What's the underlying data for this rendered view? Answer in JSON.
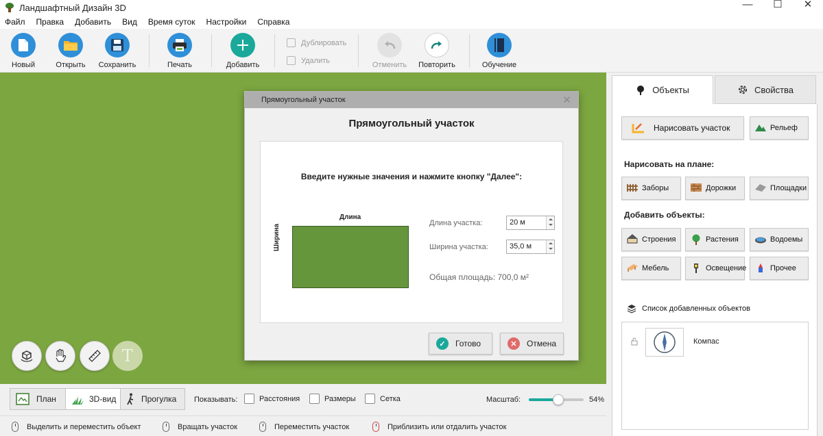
{
  "window": {
    "title": "Ландшафтный Дизайн 3D",
    "minimize_glyph": "—",
    "maximize_glyph": "☐",
    "close_glyph": "✕"
  },
  "menu": [
    "Файл",
    "Правка",
    "Добавить",
    "Вид",
    "Время суток",
    "Настройки",
    "Справка"
  ],
  "toolbar": {
    "new": "Новый",
    "open": "Открыть",
    "save": "Сохранить",
    "print": "Печать",
    "add": "Добавить",
    "duplicate": "Дублировать",
    "delete": "Удалить",
    "undo": "Отменить",
    "redo": "Повторить",
    "tutorial": "Обучение"
  },
  "canvas_tools": {
    "text_tool_glyph": "T"
  },
  "dialog": {
    "title": "Прямоугольный участок",
    "heading": "Прямоугольный участок",
    "instruction": "Введите нужные значения и нажмите кнопку \"Далее\":",
    "diagram_length_label": "Длина",
    "diagram_width_label": "Ширина",
    "length_label": "Длина участка:",
    "length_value": "20 м",
    "width_label": "Ширина участка:",
    "width_value": "35,0 м",
    "total_area": "Общая площадь:  700,0 м²",
    "ok": "Готово",
    "cancel": "Отмена",
    "close_glyph": "✕"
  },
  "right_panel": {
    "tab_objects": "Объекты",
    "tab_properties": "Свойства",
    "draw_plot": "Нарисовать участок",
    "relief": "Рельеф",
    "draw_on_plan_header": "Нарисовать на плане:",
    "fences": "Заборы",
    "paths": "Дорожки",
    "areas": "Площадки",
    "add_objects_header": "Добавить объекты:",
    "buildings": "Строения",
    "plants": "Растения",
    "ponds": "Водоемы",
    "furniture": "Мебель",
    "lighting": "Освещение",
    "other": "Прочее",
    "list_header": "Список добавленных объектов",
    "list_items": [
      {
        "name": "Компас"
      }
    ]
  },
  "view_bar": {
    "plan": "План",
    "view3d": "3D-вид",
    "walk": "Прогулка",
    "show_label": "Показывать:",
    "distances": "Расстояния",
    "sizes": "Размеры",
    "grid": "Сетка",
    "scale_label": "Масштаб:",
    "scale_value": "54%",
    "scale_fraction": 0.54
  },
  "status": {
    "left_click": "Выделить и переместить объект",
    "right_click": "Вращать участок",
    "middle_click": "Переместить участок",
    "wheel": "Приблизить или отдалить участок"
  }
}
